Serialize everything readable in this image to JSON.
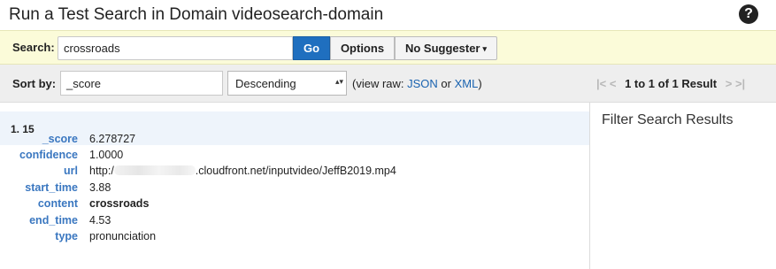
{
  "header": {
    "title": "Run a Test Search in Domain videosearch-domain",
    "help_icon": "?"
  },
  "search": {
    "label": "Search:",
    "value": "crossroads",
    "go_label": "Go",
    "options_label": "Options",
    "suggester_label": "No Suggester",
    "suggester_caret": "▾"
  },
  "sort": {
    "label": "Sort by:",
    "field_value": "_score",
    "order_value": "Descending",
    "order_arrow": "▴▾",
    "view_raw_prefix": "(view raw: ",
    "json_link": "JSON",
    "or_text": " or ",
    "xml_link": "XML",
    "view_raw_suffix": ")"
  },
  "pager": {
    "first_icon": "|<",
    "prev_icon": "<",
    "text": "1 to 1 of 1 Result",
    "next_icon": ">",
    "last_icon": ">|"
  },
  "result": {
    "number": "1. 15",
    "fields": [
      {
        "name": "_score",
        "value": "6.278727"
      },
      {
        "name": "confidence",
        "value": "1.0000"
      },
      {
        "name": "url",
        "value_prefix": "http:/",
        "value_suffix": ".cloudfront.net/inputvideo/JeffB2019.mp4"
      },
      {
        "name": "start_time",
        "value": "3.88"
      },
      {
        "name": "content",
        "value": "crossroads"
      },
      {
        "name": "end_time",
        "value": "4.53"
      },
      {
        "name": "type",
        "value": "pronunciation"
      }
    ]
  },
  "filter": {
    "title": "Filter Search Results"
  }
}
